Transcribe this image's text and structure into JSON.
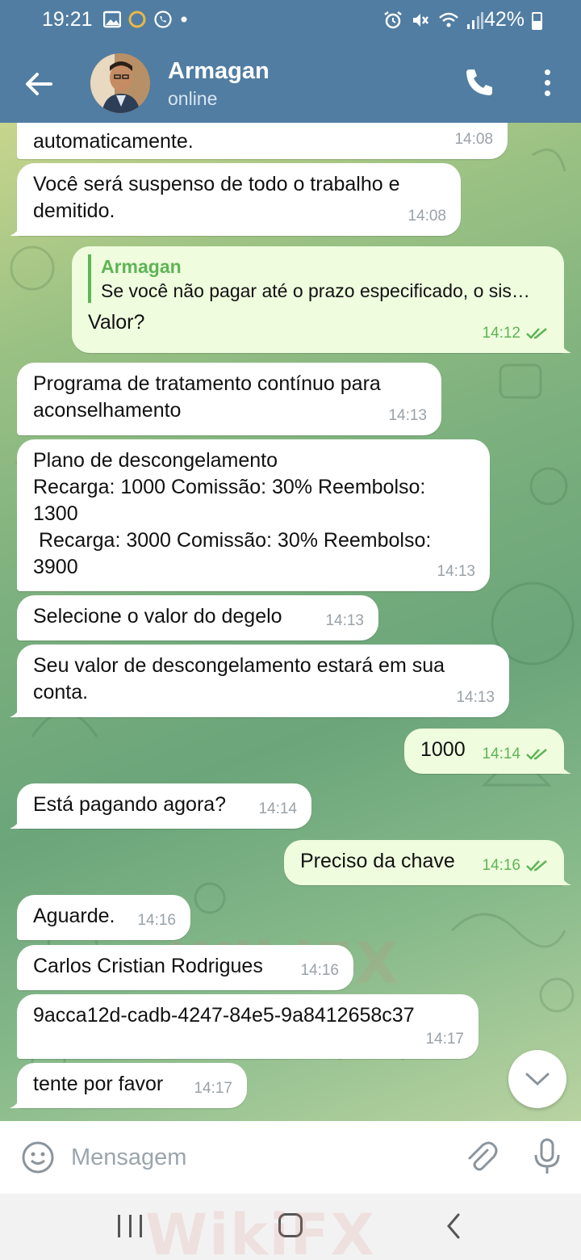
{
  "status_bar": {
    "time": "19:21",
    "battery": "42%"
  },
  "header": {
    "name": "Armagan",
    "status": "online"
  },
  "messages": [
    {
      "dir": "in",
      "text": "automaticamente.",
      "time": "14:08"
    },
    {
      "dir": "in",
      "text": "Você será suspenso de todo o trabalho e\ndemitido.",
      "time": "14:08"
    },
    {
      "dir": "out",
      "reply_name": "Armagan",
      "reply_text": "Se você não pagar até o prazo especificado, o sis…",
      "text": "Valor?",
      "time": "14:12"
    },
    {
      "dir": "in",
      "text": "Programa de tratamento contínuo para\naconselhamento",
      "time": "14:13"
    },
    {
      "dir": "in",
      "text": "Plano de descongelamento\nRecarga: 1000 Comissão: 30% Reembolso:\n1300\n Recarga: 3000 Comissão: 30% Reembolso:\n3900",
      "time": "14:13"
    },
    {
      "dir": "in",
      "text": "Selecione o valor do degelo",
      "time": "14:13"
    },
    {
      "dir": "in",
      "text": "Seu valor de descongelamento estará em sua\nconta.",
      "time": "14:13"
    },
    {
      "dir": "out",
      "text": "1000",
      "time": "14:14"
    },
    {
      "dir": "in",
      "text": "Está pagando agora?",
      "time": "14:14"
    },
    {
      "dir": "out",
      "text": "Preciso da chave",
      "time": "14:16"
    },
    {
      "dir": "in",
      "text": "Aguarde.",
      "time": "14:16"
    },
    {
      "dir": "in",
      "text": "Carlos Cristian Rodrigues",
      "time": "14:16"
    },
    {
      "dir": "in",
      "text": "9acca12d-cadb-4247-84e5-9a8412658c37",
      "time": "14:17"
    },
    {
      "dir": "in",
      "text": "tente por favor",
      "time": "14:17"
    }
  ],
  "input": {
    "placeholder": "Mensagem"
  },
  "watermark": "WikiFX",
  "colors": {
    "header": "#517da2",
    "outgoing_bubble": "#effdde",
    "accent_green": "#5fb456"
  }
}
